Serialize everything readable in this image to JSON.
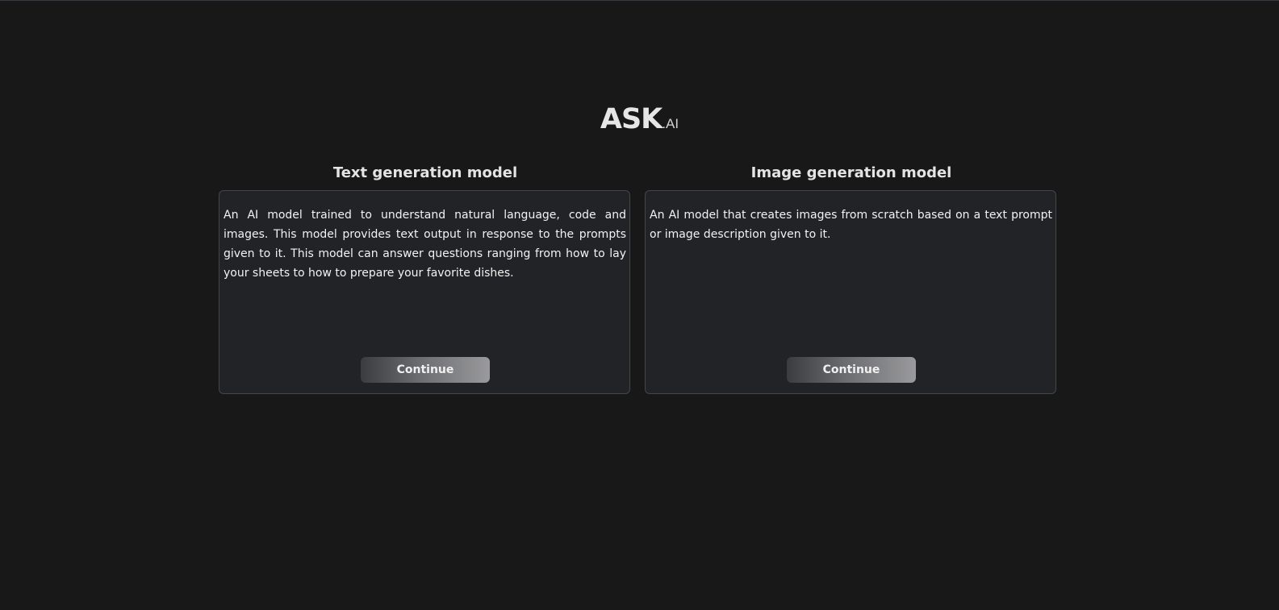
{
  "header": {
    "logo_main": "ASK",
    "logo_suffix": ".AI"
  },
  "cards": [
    {
      "title": "Text generation model",
      "description": "An AI model trained to understand natural language, code and images. This model provides text output in response to the prompts given to it. This model can answer questions ranging from how to lay your sheets to how to prepare your favorite dishes.",
      "button_label": "Continue"
    },
    {
      "title": "Image generation model",
      "description": "An AI model that creates images from scratch based on a text prompt or image description given to it.",
      "button_label": "Continue"
    }
  ],
  "colors": {
    "background": "#181818",
    "card_background": "#222326",
    "card_border": "#44464c",
    "text": "#f2f2f2",
    "button_gradient_start": "#3b3c40",
    "button_gradient_end": "#9a9a9c"
  }
}
